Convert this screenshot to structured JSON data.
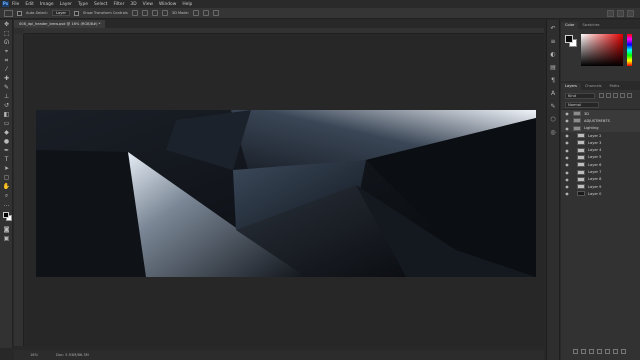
{
  "menubar": {
    "logo": "Ps",
    "items": [
      "File",
      "Edit",
      "Image",
      "Layer",
      "Type",
      "Select",
      "Filter",
      "3D",
      "View",
      "Window",
      "Help"
    ]
  },
  "options": {
    "auto_select": "Auto-Select:",
    "auto_select_value": "Layer",
    "show_transform": "Show Transform Controls",
    "mode_3d": "3D Mode:"
  },
  "document": {
    "tab_label": "008_dpi_header_bmw.psd @ 16% (RGB/8#) *"
  },
  "status": {
    "zoom": "16%",
    "doc_size": "Doc: 5.93M/86.3M"
  },
  "color_panel": {
    "tabs": [
      "Color",
      "Swatches"
    ]
  },
  "layers_panel": {
    "tabs": [
      "Layers",
      "Channels",
      "Paths"
    ],
    "kind": "Kind",
    "blend_mode": "Normal",
    "layers": [
      {
        "name": "3D",
        "type": "folder"
      },
      {
        "name": "ADJUSTMENTS",
        "type": "folder"
      },
      {
        "name": "Lighting",
        "type": "folder"
      },
      {
        "name": "Layer 2",
        "type": "layer"
      },
      {
        "name": "Layer 3",
        "type": "layer"
      },
      {
        "name": "Layer 4",
        "type": "layer"
      },
      {
        "name": "Layer 5",
        "type": "layer"
      },
      {
        "name": "Layer 6",
        "type": "layer"
      },
      {
        "name": "Layer 7",
        "type": "layer"
      },
      {
        "name": "Layer 8",
        "type": "layer"
      },
      {
        "name": "Layer 9",
        "type": "layer"
      },
      {
        "name": "Layer 0",
        "type": "layer"
      }
    ]
  },
  "colors": {
    "app_bg": "#282828",
    "panel_bg": "#323232",
    "artwork_dark": "#0c0f14",
    "artwork_highlight": "#e8eef6"
  }
}
